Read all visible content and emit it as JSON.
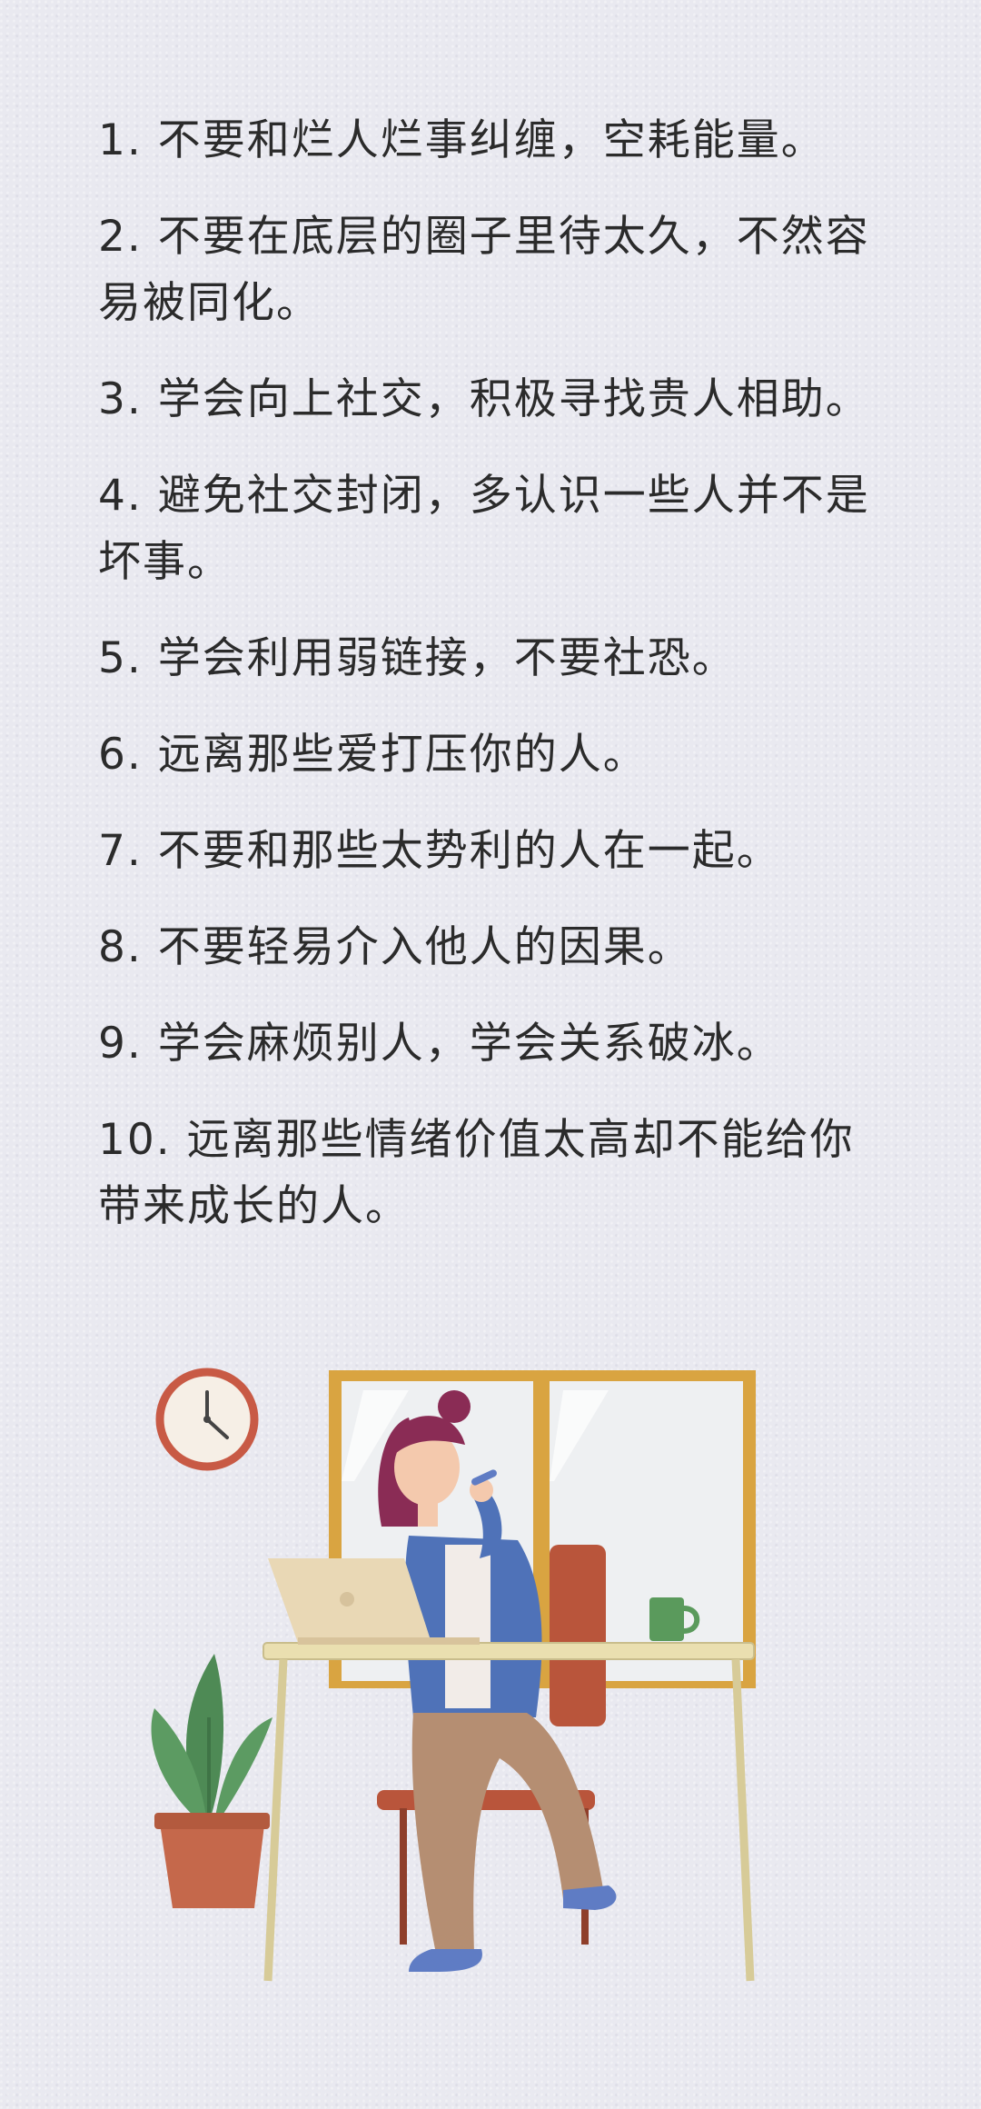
{
  "tips": [
    {
      "lines": [
        "1. 不要和烂人烂事纠缠，空耗能量。"
      ]
    },
    {
      "lines": [
        "2. 不要在底层的圈子里待太久，不然容",
        "易被同化。"
      ]
    },
    {
      "lines": [
        "3. 学会向上社交，积极寻找贵人相助。"
      ]
    },
    {
      "lines": [
        "4. 避免社交封闭，多认识一些人并不是",
        "坏事。"
      ]
    },
    {
      "lines": [
        "5. 学会利用弱链接，不要社恐。"
      ]
    },
    {
      "lines": [
        "6. 远离那些爱打压你的人。"
      ]
    },
    {
      "lines": [
        "7. 不要和那些太势利的人在一起。"
      ]
    },
    {
      "lines": [
        "8. 不要轻易介入他人的因果。"
      ]
    },
    {
      "lines": [
        "9. 学会麻烦别人，学会关系破冰。"
      ]
    },
    {
      "lines": [
        "10. 远离那些情绪价值太高却不能给你",
        "带来成长的人。"
      ]
    }
  ],
  "illustration": {
    "icons": [
      "wall-clock-icon",
      "window-icon",
      "woman-on-phone-icon",
      "laptop-icon",
      "mug-icon",
      "desk-icon",
      "chair-icon",
      "potted-plant-icon"
    ],
    "colors": {
      "window_frame": "#d9a441",
      "hair": "#8a2c55",
      "jacket": "#4f72b8",
      "pants": "#b58e72",
      "chair": "#b9553b",
      "desk": "#eadfb0",
      "plant": "#4e8a55",
      "pot": "#c5684b",
      "clock_rim": "#c85a45",
      "mug": "#5a9a5c"
    }
  }
}
